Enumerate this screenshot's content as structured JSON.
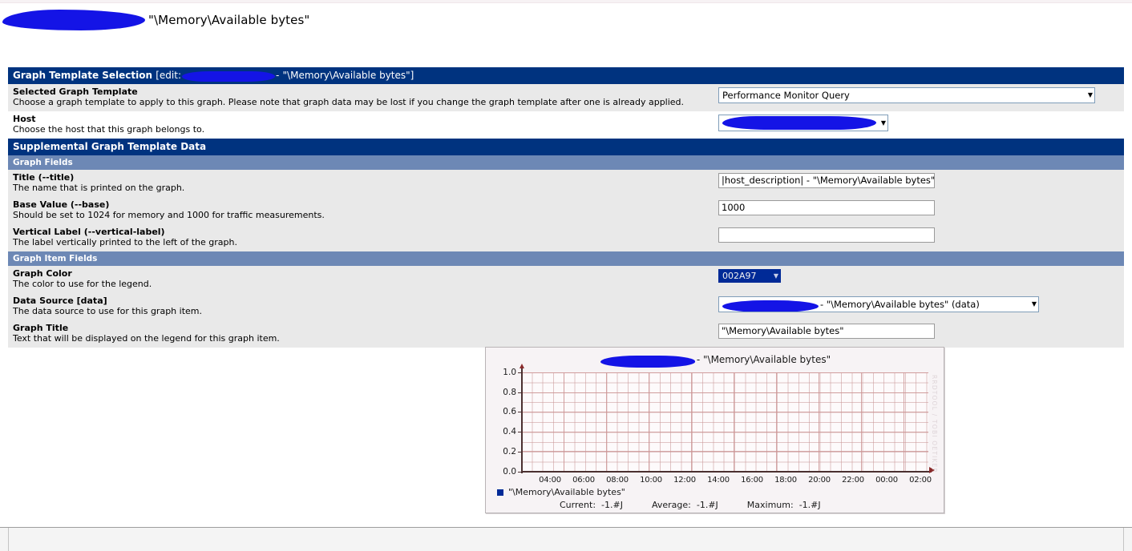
{
  "page": {
    "heading_suffix": "\"\\Memory\\Available bytes\"",
    "redacted_host": ""
  },
  "graph_template_selection": {
    "bar_title": "Graph Template Selection",
    "bar_edit_prefix": "[edit:",
    "bar_edit_dash": "-",
    "bar_edit_name": "\"\\Memory\\Available bytes\"]",
    "rows": [
      {
        "label": "Selected Graph Template",
        "description": "Choose a graph template to apply to this graph. Please note that graph data may be lost if you change the graph template after one is already applied.",
        "value": "Performance Monitor Query"
      },
      {
        "label": "Host",
        "description": "Choose the host that this graph belongs to.",
        "value": ""
      }
    ]
  },
  "supplemental": {
    "bar_title": "Supplemental Graph Template Data",
    "graph_fields_header": "Graph Fields",
    "graph_fields": [
      {
        "label": "Title (--title)",
        "description": "The name that is printed on the graph.",
        "value": "|host_description| - \"\\Memory\\Available bytes\""
      },
      {
        "label": "Base Value (--base)",
        "description": "Should be set to 1024 for memory and 1000 for traffic measurements.",
        "value": "1000"
      },
      {
        "label": "Vertical Label (--vertical-label)",
        "description": "The label vertically printed to the left of the graph.",
        "value": ""
      }
    ],
    "graph_item_fields_header": "Graph Item Fields",
    "graph_item_fields": [
      {
        "label": "Graph Color",
        "description": "The color to use for the legend.",
        "value": "002A97"
      },
      {
        "label": "Data Source [data]",
        "description": "The data source to use for this graph item.",
        "value": "- \"\\Memory\\Available bytes\" (data)"
      },
      {
        "label": "Graph Title",
        "description": "Text that will be displayed on the legend for this graph item.",
        "value": "\"\\Memory\\Available bytes\""
      }
    ]
  },
  "colors": {
    "header_bar": "#00337f",
    "subheader_bar": "#6d88b5",
    "graph_color": "#002a97",
    "redaction": "#1414e6"
  },
  "graph_preview": {
    "title_suffix": "- \"\\Memory\\Available bytes\"",
    "watermark": "RRDTOOL / TOBI OETIKER",
    "legend_label": "\"\\Memory\\Available bytes\"",
    "stats": [
      {
        "key": "Current:",
        "value": "-1.#J"
      },
      {
        "key": "Average:",
        "value": "-1.#J"
      },
      {
        "key": "Maximum:",
        "value": "-1.#J"
      }
    ]
  },
  "chart_data": {
    "type": "line",
    "title": "|host_description| - \"\\Memory\\Available bytes\"",
    "xlabel": "",
    "ylabel": "",
    "grid": true,
    "legend_position": "bottom-left",
    "ylim": [
      0.0,
      1.0
    ],
    "yticks": [
      "0.0",
      "0.2",
      "0.4",
      "0.6",
      "0.8",
      "1.0"
    ],
    "xticks": [
      "04:00",
      "06:00",
      "08:00",
      "10:00",
      "12:00",
      "14:00",
      "16:00",
      "18:00",
      "20:00",
      "22:00",
      "00:00",
      "02:00"
    ],
    "series": [
      {
        "name": "\"\\Memory\\Available bytes\"",
        "color": "#002a97",
        "values": [],
        "current": "-1.#J",
        "average": "-1.#J",
        "maximum": "-1.#J"
      }
    ]
  }
}
